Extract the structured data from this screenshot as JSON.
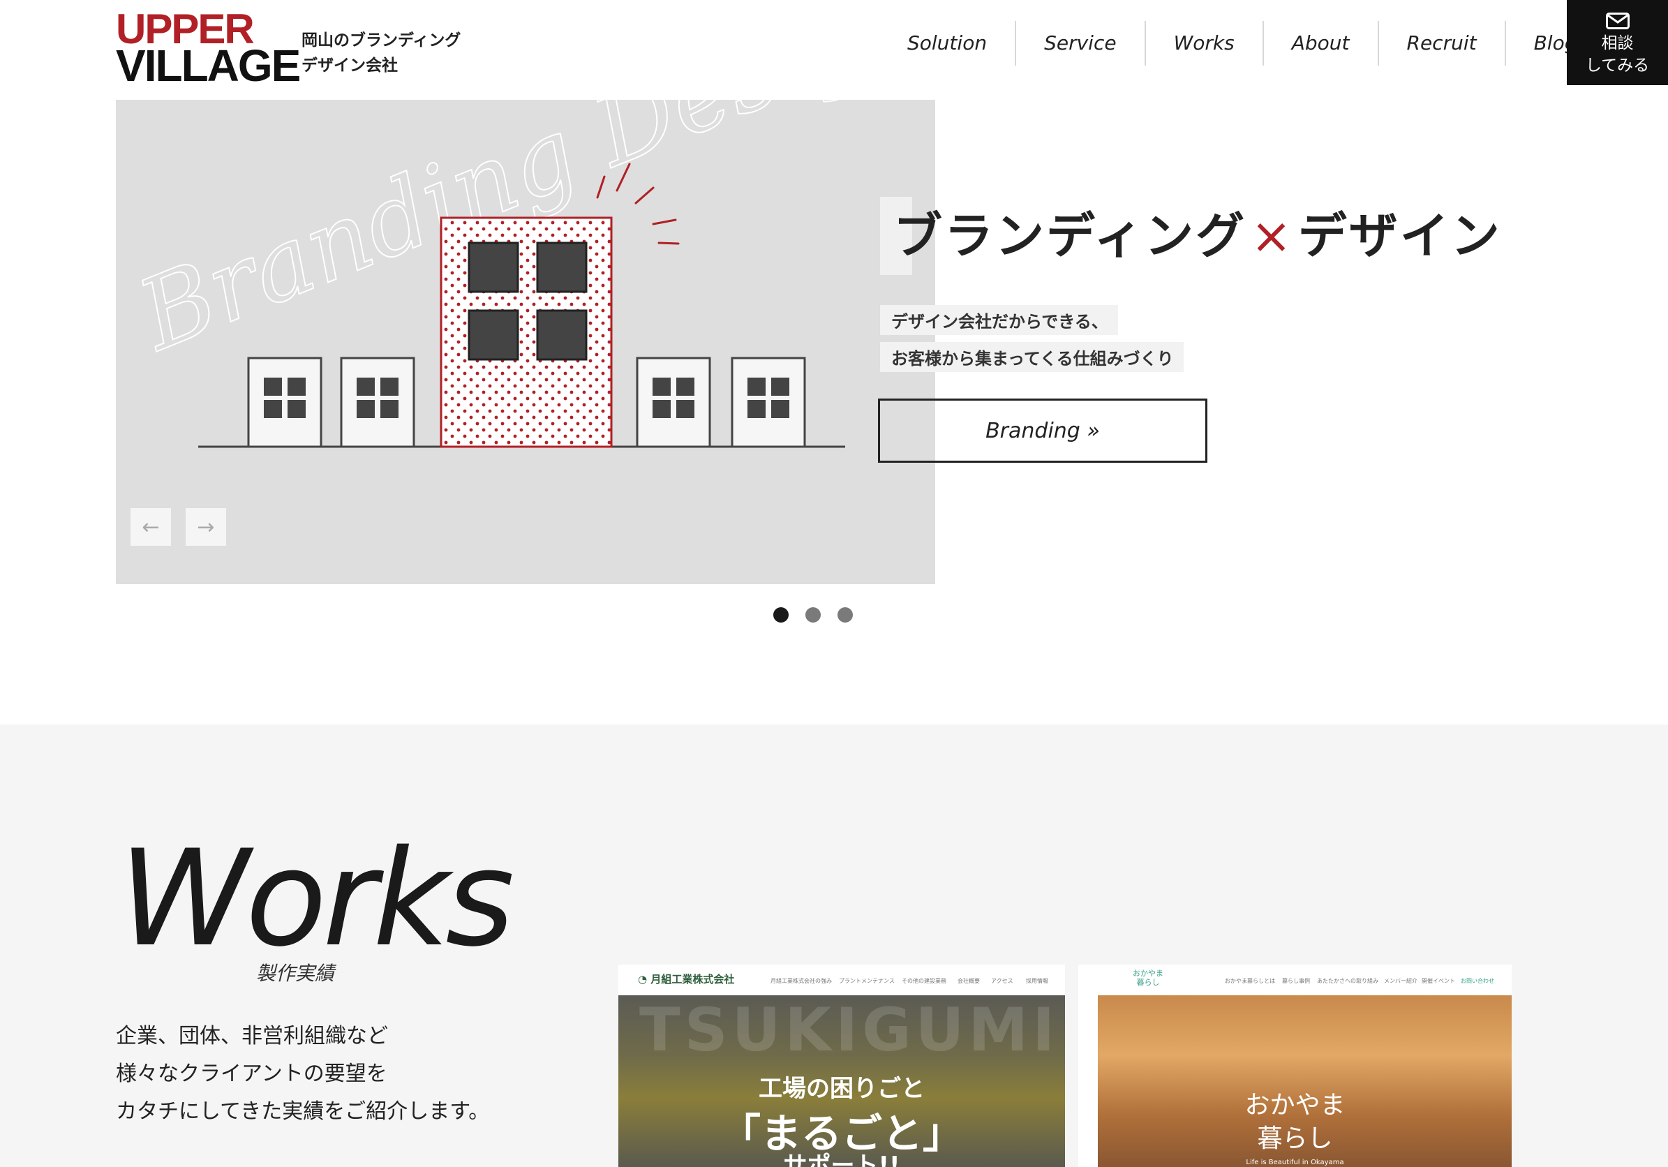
{
  "header": {
    "logo_line1": "UPPER",
    "logo_line2": "VILLAGE",
    "tagline_line1": "岡山のブランディング",
    "tagline_line2": "デザイン会社",
    "nav": [
      {
        "label": "Solution"
      },
      {
        "label": "Service"
      },
      {
        "label": "Works"
      },
      {
        "label": "About"
      },
      {
        "label": "Recruit"
      },
      {
        "label": "Blog"
      }
    ],
    "consult_line1": "相談",
    "consult_line2": "してみる"
  },
  "hero": {
    "script_text": "Branding Design",
    "title_part1": "ブランディング",
    "title_cross": "×",
    "title_part2": "デザイン",
    "sub_line1": "デザイン会社だからできる、",
    "sub_line2": "お客様から集まってくる仕組みづくり",
    "button_label": "Branding »",
    "prev_arrow": "←",
    "next_arrow": "→",
    "slide_count": 3,
    "active_slide": 1,
    "accent_color": "#b02026"
  },
  "works": {
    "title": "Works",
    "subtitle": "製作実績",
    "desc_line1": "企業、団体、非営利組織など",
    "desc_line2": "様々なクライアントの要望を",
    "desc_line3": "カタチにしてきた実績をご紹介します。",
    "card1": {
      "brand": "月組工業株式会社",
      "menu": [
        "月組工業株式会社の強み",
        "プラントメンテナンス",
        "その他の建設業務",
        "会社概要",
        "アクセス",
        "採用情報"
      ],
      "bigword": "TSUKIGUMI",
      "copy1": "工場の困りごと",
      "copy2": "「まるごと」",
      "copy3": "サポート!!"
    },
    "card2": {
      "logo_line1": "おかやま",
      "logo_line2": "暮らし",
      "menu": [
        "おかやま暮らしとは",
        "暮らし事例",
        "あたたかさへの取り組み",
        "メンバー紹介",
        "開催イベント",
        "お問い合わせ"
      ],
      "copy_line1": "おかやま",
      "copy_line2": "暮らし",
      "english": "Life is Beautiful in Okayama"
    }
  }
}
